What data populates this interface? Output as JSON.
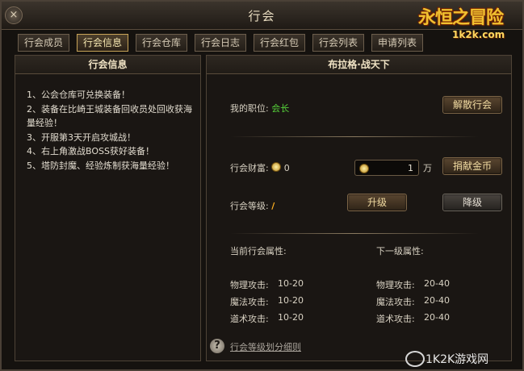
{
  "window": {
    "title": "行会",
    "close": "×"
  },
  "logo": {
    "main": "永恒之冒险",
    "sub": "1k2k.com"
  },
  "tabs": [
    {
      "label": "行会成员",
      "active": false
    },
    {
      "label": "行会信息",
      "active": true
    },
    {
      "label": "行会仓库",
      "active": false
    },
    {
      "label": "行会日志",
      "active": false
    },
    {
      "label": "行会红包",
      "active": false
    },
    {
      "label": "行会列表",
      "active": false
    },
    {
      "label": "申请列表",
      "active": false
    }
  ],
  "left_panel": {
    "title": "行会信息",
    "notices": [
      "1、公会仓库可兑换装备！",
      "2、装备在比崎王城装备回收员处回收获海量经验！",
      "3、开服第3天开启攻城战！",
      "4、右上角激战BOSS获好装备！",
      "5、塔防封魔、经验炼制获海量经验！"
    ]
  },
  "right_panel": {
    "title": "布拉格·战天下",
    "position_label": "我的职位:",
    "position_value": "会长",
    "disband_button": "解散行会",
    "wealth_label": "行会财富:",
    "wealth_value": "0",
    "donate_amount": "1",
    "donate_unit": "万",
    "donate_button": "捐献金币",
    "level_label": "行会等级:",
    "level_value": "/",
    "upgrade_button": "升级",
    "downgrade_button": "降级",
    "current_attr_title": "当前行会属性:",
    "next_attr_title": "下一级属性:",
    "current_attrs": [
      {
        "name": "物理攻击:",
        "value": "10-20"
      },
      {
        "name": "魔法攻击:",
        "value": "10-20"
      },
      {
        "name": "道术攻击:",
        "value": "10-20"
      }
    ],
    "next_attrs": [
      {
        "name": "物理攻击:",
        "value": "20-40"
      },
      {
        "name": "魔法攻击:",
        "value": "20-40"
      },
      {
        "name": "道术攻击:",
        "value": "20-40"
      }
    ],
    "help_icon": "?",
    "help_link": "行会等级划分细则"
  },
  "watermark": "1K2K游戏网",
  "colors": {
    "accent_gold": "#c8a458",
    "value_green": "#56d33a"
  }
}
